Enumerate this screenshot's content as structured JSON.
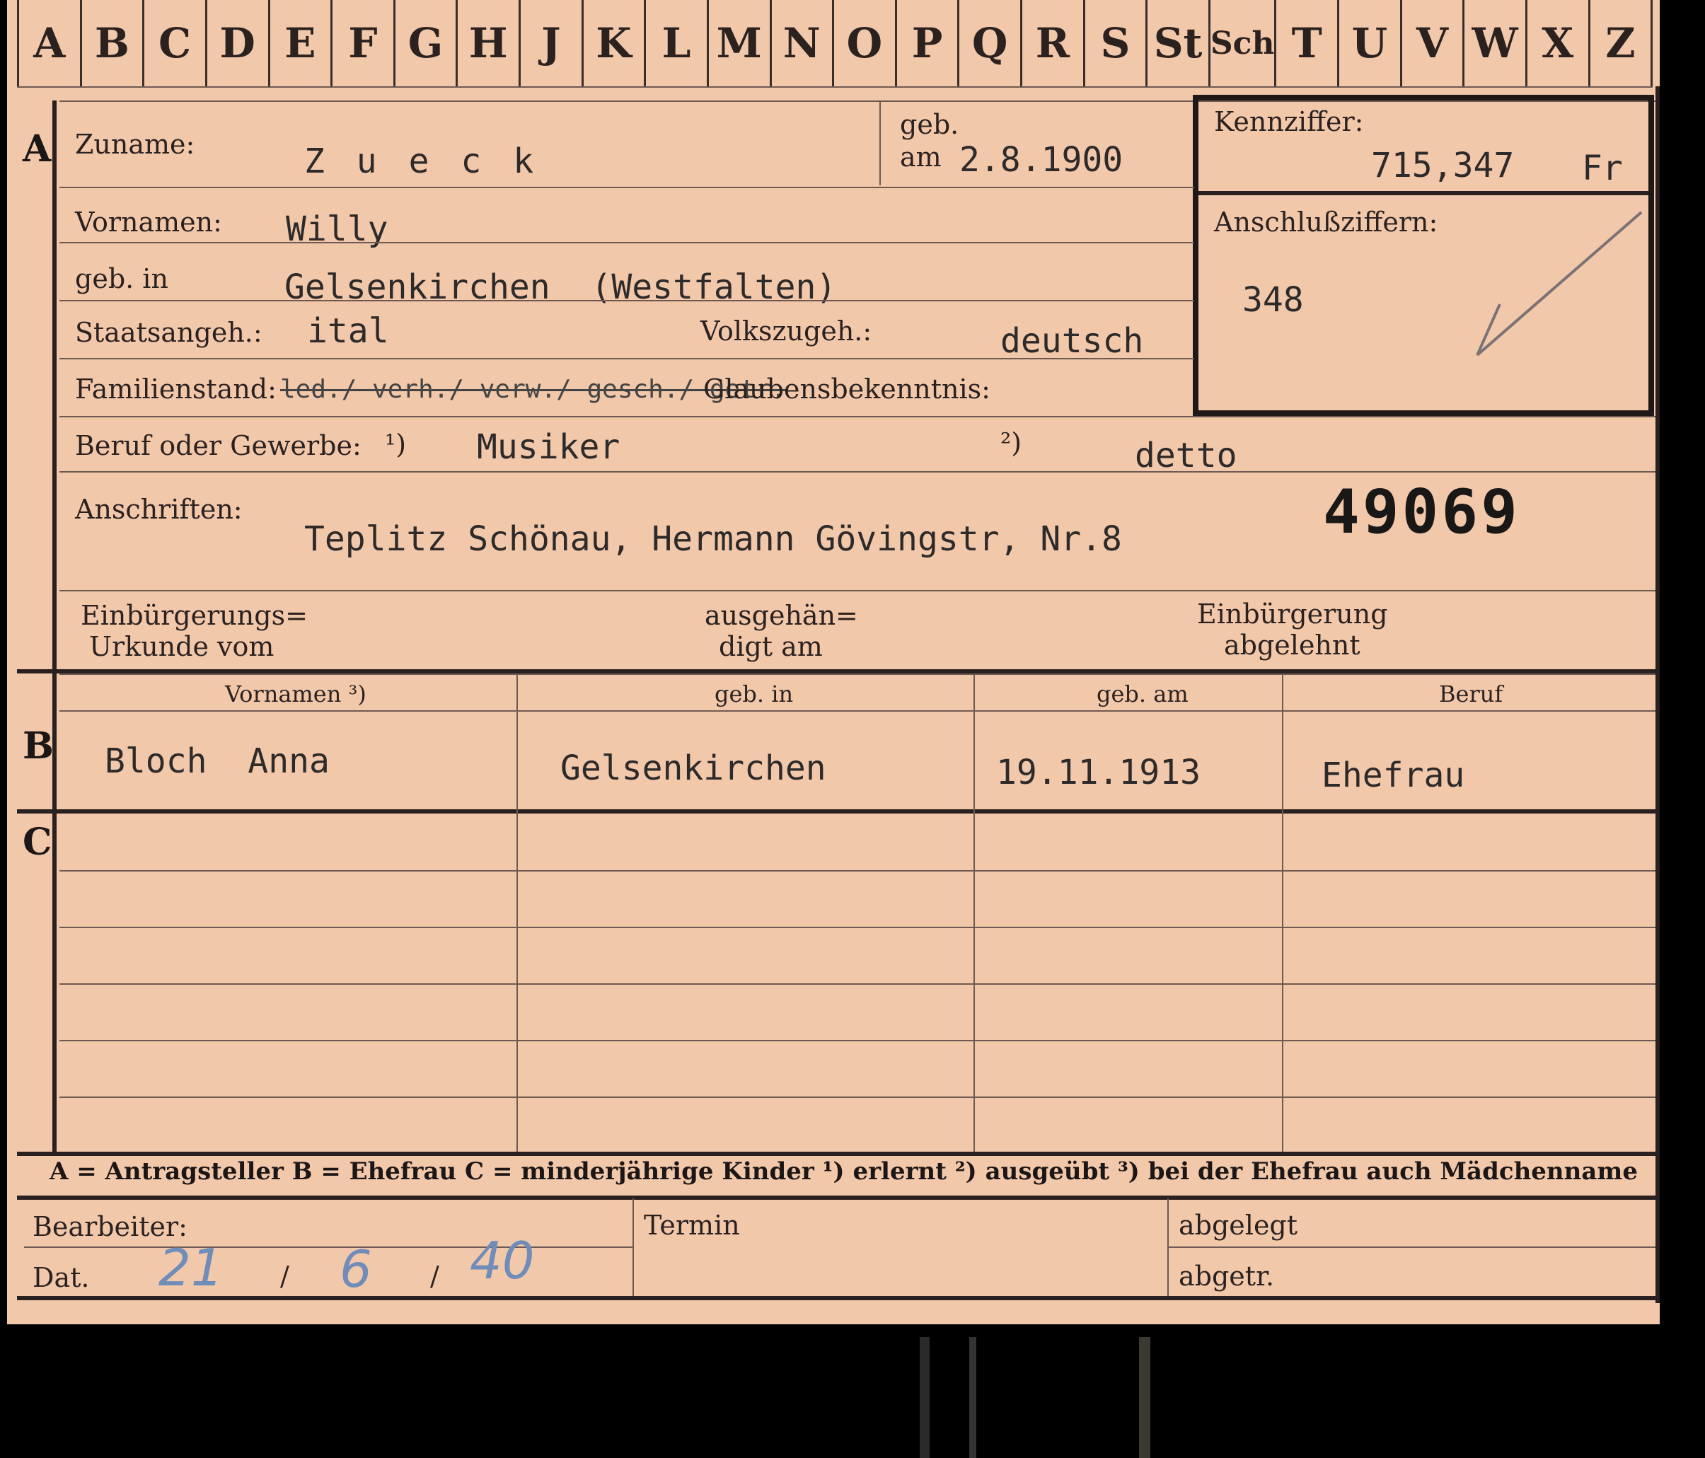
{
  "tabs": [
    "A",
    "B",
    "C",
    "D",
    "E",
    "F",
    "G",
    "H",
    "J",
    "K",
    "L",
    "M",
    "N",
    "O",
    "P",
    "Q",
    "R",
    "S",
    "St",
    "Sch",
    "T",
    "U",
    "V",
    "W",
    "X",
    "Z"
  ],
  "sections": {
    "a": "A",
    "b": "B",
    "c": "C"
  },
  "labels": {
    "zuname": "Zuname:",
    "geb": "geb.",
    "am": "am",
    "kennziffer": "Kennziffer:",
    "anschluss": "Anschlußziffern:",
    "vornamen": "Vornamen:",
    "geb_in": "geb. in",
    "staatsangeh": "Staatsangeh.:",
    "volkszugeh": "Volkszugeh.:",
    "familienstand": "Familienstand:",
    "glaubens": "Glaubensbekenntnis:",
    "beruf": "Beruf oder Gewerbe:",
    "beruf_note1": "¹)",
    "beruf_note2": "²)",
    "anschriften": "Anschriften:",
    "einb_urkunde_1": "Einbürgerungs=",
    "einb_urkunde_2": "Urkunde vom",
    "ausgehaendigt_1": "ausgehän=",
    "ausgehaendigt_2": "digt am",
    "einb_abgelehnt_1": "Einbürgerung",
    "einb_abgelehnt_2": "abgelehnt",
    "col_vornamen": "Vornamen ³)",
    "col_geb_in": "geb. in",
    "col_geb_am": "geb. am",
    "col_beruf": "Beruf",
    "legend": "A = Antragsteller   B = Ehefrau   C = minderjährige Kinder   ¹) erlernt   ²) ausgeübt   ³) bei der Ehefrau auch Mädchenname",
    "bearbeiter": "Bearbeiter:",
    "dat": "Dat.",
    "termin": "Termin",
    "abgelegt": "abgelegt",
    "abgetr": "abgetr."
  },
  "applicant": {
    "zuname": "Z u e c k",
    "geb_am": "2.8.1900",
    "kennziffer": "715,347",
    "kennziffer_suffix": "Fr",
    "anschlussziffer": "348",
    "vornamen": "Willy",
    "geb_in": "Gelsenkirchen  (Westfalten)",
    "staatsangeh": "ital",
    "volkszugeh": "deutsch",
    "familienstand_options": "led./ verh./ verw./ gesch./ getr.",
    "beruf_erlernt": "Musiker",
    "beruf_ausgeuebt": "detto",
    "anschrift": "Teplitz Schönau, Hermann Gövingstr, Nr.8",
    "stamp_number": "49069"
  },
  "spouse": {
    "vornamen": "Bloch  Anna",
    "geb_in": "Gelsenkirchen",
    "geb_am": "19.11.1913",
    "beruf": "Ehefrau"
  },
  "date": {
    "day": "21",
    "month": "6",
    "year": "40",
    "sep": "/"
  }
}
